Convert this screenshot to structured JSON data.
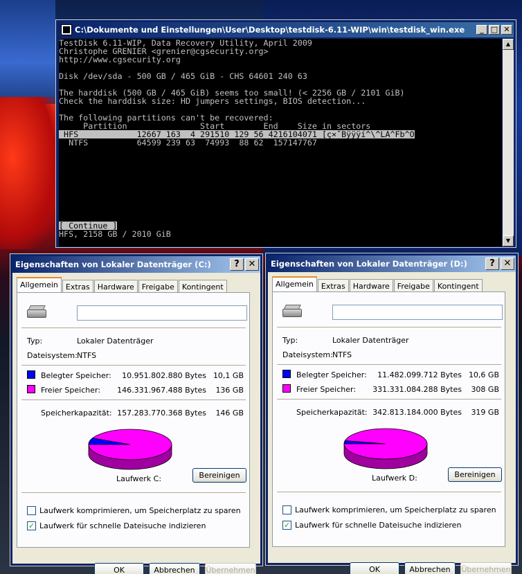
{
  "cmd": {
    "title": "C:\\Dokumente und Einstellungen\\User\\Desktop\\testdisk-6.11-WIP\\win\\testdisk_win.exe",
    "minimize": "_",
    "maximize": "□",
    "close": "✕",
    "lines": [
      "TestDisk 6.11-WIP, Data Recovery Utility, April 2009",
      "Christophe GRENIER <grenier@cgsecurity.org>",
      "http://www.cgsecurity.org",
      "",
      "Disk /dev/sda - 500 GB / 465 GiB - CHS 64601 240 63",
      "",
      "The harddisk (500 GB / 465 GiB) seems too small! (< 2256 GB / 2101 GiB)",
      "Check the harddisk size: HD jumpers settings, BIOS detection...",
      "",
      "The following partitions can't be recovered:",
      "     Partition               Start        End    Size in sectors"
    ],
    "selected_row": " HFS            12667 163  4 291510 129 56 4216104071 [ç×ˆBÿÿÿí^\\^LA^Fb^O",
    "other_row": "  NTFS          64599 239 63  74993  88 62  157147767",
    "continue": "[ Continue ]",
    "status": "HFS, 2158 GB / 2010 GiB"
  },
  "dialogs": [
    {
      "title": "Eigenschaften von Lokaler Datenträger (C:)",
      "help": "?",
      "close": "✕",
      "tabs": [
        "Allgemein",
        "Extras",
        "Hardware",
        "Freigabe",
        "Kontingent"
      ],
      "type_label": "Typ:",
      "type_value": "Lokaler Datenträger",
      "fs_label": "Dateisystem:",
      "fs_value": "NTFS",
      "used_label": "Belegter Speicher:",
      "used_bytes": "10.951.802.880 Bytes",
      "used_gb": "10,1 GB",
      "free_label": "Freier Speicher:",
      "free_bytes": "146.331.967.488 Bytes",
      "free_gb": "136 GB",
      "cap_label": "Speicherkapazität:",
      "cap_bytes": "157.283.770.368 Bytes",
      "cap_gb": "146 GB",
      "used_fraction": 0.0696,
      "drive_label": "Laufwerk C:",
      "cleanup": "Bereinigen",
      "compress": "Laufwerk komprimieren, um Speicherplatz zu sparen",
      "index": "Laufwerk für schnelle Dateisuche indizieren",
      "ok": "OK",
      "cancel": "Abbrechen",
      "apply": "Übernehmen"
    },
    {
      "title": "Eigenschaften von Lokaler Datenträger (D:)",
      "help": "?",
      "close": "✕",
      "tabs": [
        "Allgemein",
        "Extras",
        "Hardware",
        "Freigabe",
        "Kontingent"
      ],
      "type_label": "Typ:",
      "type_value": "Lokaler Datenträger",
      "fs_label": "Dateisystem:",
      "fs_value": "NTFS",
      "used_label": "Belegter Speicher:",
      "used_bytes": "11.482.099.712 Bytes",
      "used_gb": "10,6 GB",
      "free_label": "Freier Speicher:",
      "free_bytes": "331.331.084.288 Bytes",
      "free_gb": "308 GB",
      "cap_label": "Speicherkapazität:",
      "cap_bytes": "342.813.184.000 Bytes",
      "cap_gb": "319 GB",
      "used_fraction": 0.0335,
      "drive_label": "Laufwerk D:",
      "cleanup": "Bereinigen",
      "compress": "Laufwerk komprimieren, um Speicherplatz zu sparen",
      "index": "Laufwerk für schnelle Dateisuche indizieren",
      "ok": "OK",
      "cancel": "Abbrechen",
      "apply": "Übernehmen"
    }
  ],
  "colors": {
    "used": "#0000ff",
    "free": "#ff00ff",
    "titlebar": "#0a246a"
  }
}
